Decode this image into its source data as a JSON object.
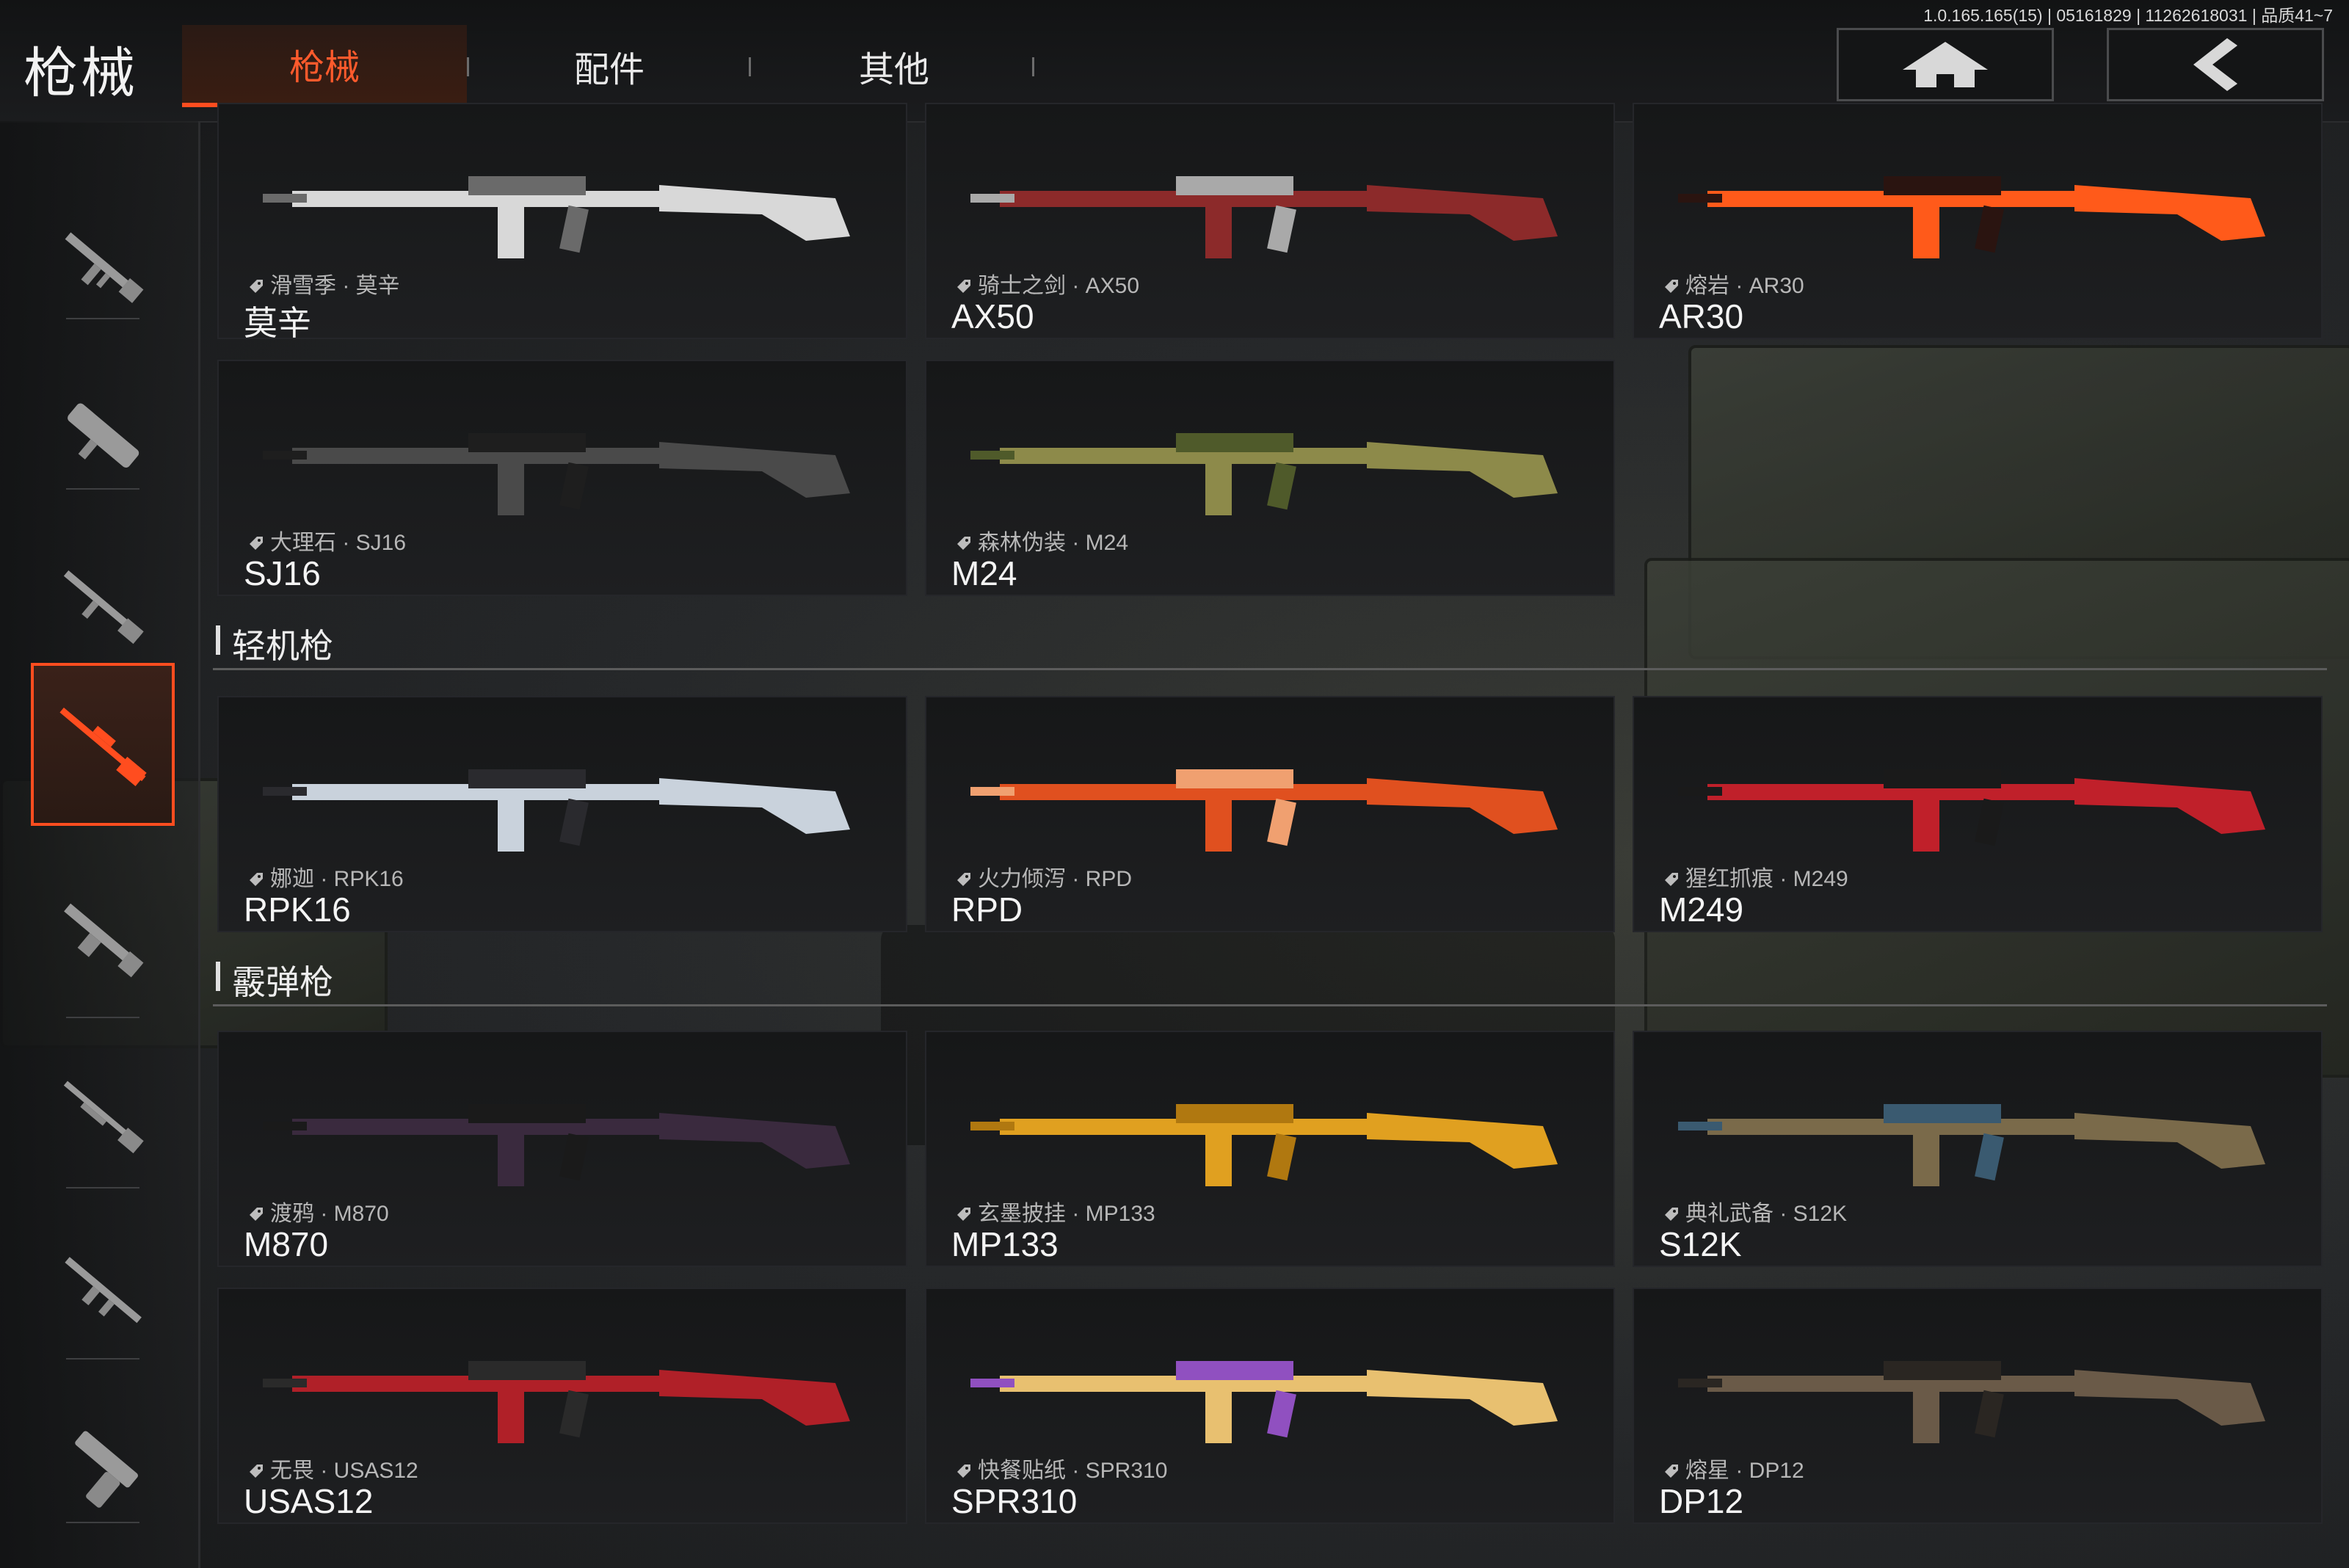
{
  "app": {
    "title": "枪械",
    "version": "1.0.165.165(15) | 05161829 | 11262618031 | 品质41~7"
  },
  "tabs": [
    {
      "label": "枪械",
      "active": true
    },
    {
      "label": "配件",
      "active": false
    },
    {
      "label": "其他",
      "active": false
    }
  ],
  "nav": {
    "home_icon": "home-icon",
    "back_icon": "chevron-left-icon"
  },
  "sidebar": {
    "items": [
      {
        "icon": "assault-rifle-icon",
        "active": false
      },
      {
        "icon": "smg-icon",
        "active": false
      },
      {
        "icon": "dmr-icon",
        "active": false
      },
      {
        "icon": "sniper-rifle-icon",
        "active": true
      },
      {
        "icon": "lmg-icon",
        "active": false
      },
      {
        "icon": "shotgun-icon",
        "active": false
      },
      {
        "icon": "rifle-icon",
        "active": false
      },
      {
        "icon": "pistol-icon",
        "active": false
      }
    ]
  },
  "sections": [
    {
      "title": "轻机枪"
    },
    {
      "title": "霰弹枪"
    }
  ],
  "cards": [
    {
      "skin": "滑雪季 · 莫辛",
      "name": "莫辛",
      "colors": [
        "#d8d8d8",
        "#6a6a6a"
      ]
    },
    {
      "skin": "骑士之剑 · AX50",
      "name": "AX50",
      "colors": [
        "#8c2a2a",
        "#a9a9a9"
      ]
    },
    {
      "skin": "熔岩 · AR30",
      "name": "AR30",
      "colors": [
        "#ff5a1a",
        "#2a1410"
      ]
    },
    {
      "skin": "大理石 · SJ16",
      "name": "SJ16",
      "colors": [
        "#4a4a4a",
        "#1e1e1e"
      ]
    },
    {
      "skin": "森林伪装 · M24",
      "name": "M24",
      "colors": [
        "#8d8a4a",
        "#4f5a2a"
      ]
    },
    {
      "skin": "娜迦 · RPK16",
      "name": "RPK16",
      "colors": [
        "#c9d2dc",
        "#2a2a2e"
      ]
    },
    {
      "skin": "火力倾泻 · RPD",
      "name": "RPD",
      "colors": [
        "#e0501f",
        "#f0a070"
      ]
    },
    {
      "skin": "猩红抓痕 · M249",
      "name": "M249",
      "colors": [
        "#c0202a",
        "#1a1a1a"
      ]
    },
    {
      "skin": "渡鸦 · M870",
      "name": "M870",
      "colors": [
        "#3a2a3e",
        "#1a1a1a"
      ]
    },
    {
      "skin": "玄墨披挂 · MP133",
      "name": "MP133",
      "colors": [
        "#e0a020",
        "#b07810"
      ]
    },
    {
      "skin": "典礼武备 · S12K",
      "name": "S12K",
      "colors": [
        "#7a6a4a",
        "#3a5a70"
      ]
    },
    {
      "skin": "无畏 · USAS12",
      "name": "USAS12",
      "colors": [
        "#b02028",
        "#2a2a2a"
      ]
    },
    {
      "skin": "快餐贴纸 · SPR310",
      "name": "SPR310",
      "colors": [
        "#e8c070",
        "#9050c0"
      ]
    },
    {
      "skin": "熔星 · DP12",
      "name": "DP12",
      "colors": [
        "#6a5a48",
        "#2a2622"
      ]
    }
  ]
}
